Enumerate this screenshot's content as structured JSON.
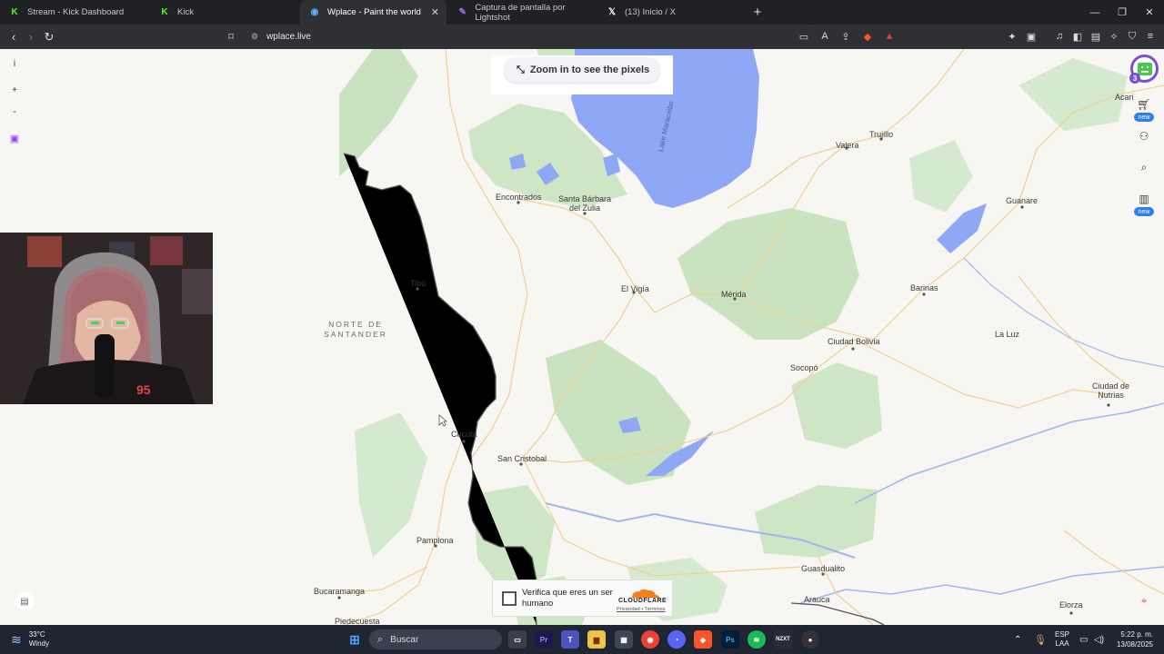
{
  "browser": {
    "tabs": [
      {
        "title": "Stream - Kick Dashboard",
        "icon": "kick-icon",
        "color": "#53fc18"
      },
      {
        "title": "Kick",
        "icon": "kick-icon",
        "color": "#53fc18"
      },
      {
        "title": "Wplace - Paint the world",
        "icon": "wplace-icon",
        "color": "#5fb3ff",
        "active": true
      },
      {
        "title": "Captura de pantalla por Lightshot",
        "icon": "lightshot-icon",
        "color": "#a86be0"
      },
      {
        "title": "(13) Inicio / X",
        "icon": "x-icon",
        "color": "#ffffff"
      }
    ],
    "url": "wplace.live",
    "shields_count": "7",
    "alert_count": "1"
  },
  "app": {
    "zoom_hint": "Zoom in to see the pixels",
    "left_controls": {
      "info": "i",
      "zoom_in": "+",
      "zoom_out": "-"
    },
    "right_controls": {
      "notification_count": "3",
      "new_label_1": "new",
      "new_label_2": "new"
    }
  },
  "map": {
    "region_label_line1": "NORTE DE",
    "region_label_line2": "SANTANDER",
    "lake_label": "Lake Maracaibo",
    "cities": {
      "valera": "Valera",
      "trujillo": "Trujillo",
      "acarigua": "Acari",
      "guanare": "Guanare",
      "encontrados": "Encontrados",
      "santa_barbara_1": "Santa Bárbara",
      "santa_barbara_2": "del Zulia",
      "tibu": "Tibú",
      "el_vigia": "El Vigía",
      "merida": "Mérida",
      "barinas": "Barinas",
      "la_luz": "La Luz",
      "ciudad_bolivia": "Ciudad Bolivia",
      "socopo": "Socopó",
      "ciudad_nutrias_1": "Ciudad de",
      "ciudad_nutrias_2": "Nutrias",
      "cucuta": "Cúcuta",
      "san_cristobal": "San Cristobal",
      "pamplona": "Pamplona",
      "guasdualito": "Guasdualito",
      "bucaramanga": "Bucaramanga",
      "arauca": "Arauca",
      "elorza": "Elorza",
      "piedecuesta": "Piedecuesta"
    }
  },
  "captcha": {
    "label": "Verifica que eres un ser humano",
    "brand": "CLOUDFLARE",
    "links": "Privacidad • Términos"
  },
  "taskbar": {
    "weather_temp": "33°C",
    "weather_desc": "Windy",
    "search_placeholder": "Buscar",
    "lang_1": "ESP",
    "lang_2": "LAA",
    "time": "5:22 p. m.",
    "date": "13/08/2025"
  },
  "colors": {
    "water": "#8fa8f5",
    "forest": "#c9e3c0",
    "roads": "#f2cf8f",
    "border": "#4a4a4a",
    "accent": "#7b4fd4"
  }
}
